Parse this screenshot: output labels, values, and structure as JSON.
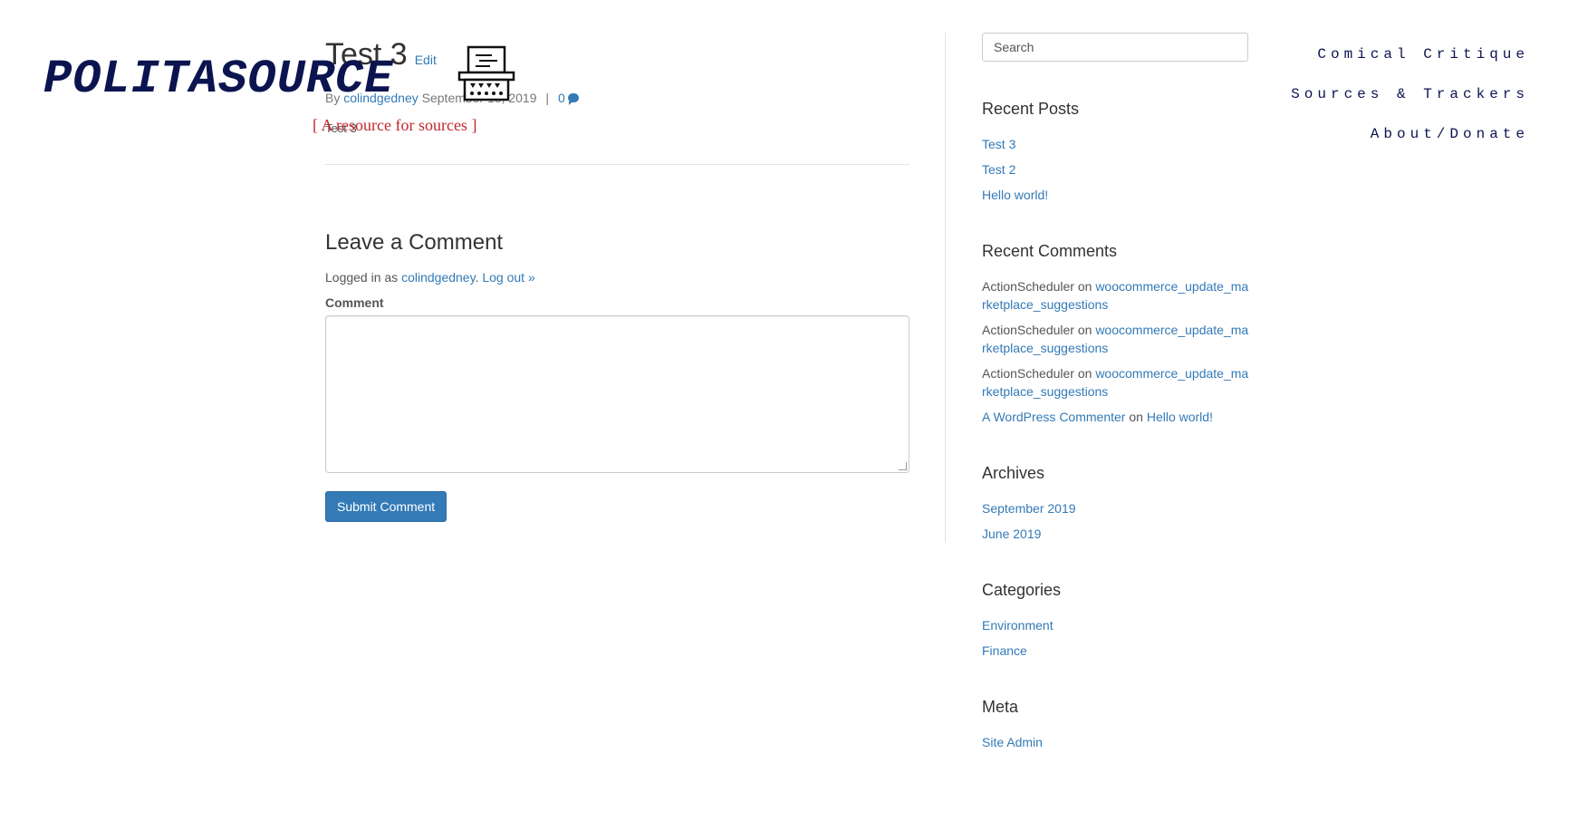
{
  "site": {
    "logo_text": "POLITASOURCE",
    "tagline": "[ A resource for sources ]"
  },
  "topnav": {
    "items": [
      "Comical Critique",
      "Sources & Trackers",
      "About/Donate"
    ]
  },
  "post": {
    "title": "Test 3",
    "edit_label": "Edit",
    "meta_by": "By",
    "author": "colindgedney",
    "date": "September 18, 2019",
    "separator": "|",
    "comment_count": "0",
    "body": "Test 3"
  },
  "comments": {
    "heading": "Leave a Comment",
    "logged_in_prefix": "Logged in as",
    "user": "colindgedney",
    "logout_label": "Log out »",
    "comment_label": "Comment",
    "submit_label": "Submit Comment"
  },
  "sidebar": {
    "search_placeholder": "Search",
    "recent_posts": {
      "title": "Recent Posts",
      "items": [
        "Test 3",
        "Test 2",
        "Hello world!"
      ]
    },
    "recent_comments": {
      "title": "Recent Comments",
      "items": [
        {
          "author": "ActionScheduler",
          "on": "on",
          "post": "woocommerce_update_marketplace_suggestions"
        },
        {
          "author": "ActionScheduler",
          "on": "on",
          "post": "woocommerce_update_marketplace_suggestions"
        },
        {
          "author": "ActionScheduler",
          "on": "on",
          "post": "woocommerce_update_marketplace_suggestions"
        },
        {
          "author": "A WordPress Commenter",
          "on": "on",
          "post": "Hello world!"
        }
      ]
    },
    "archives": {
      "title": "Archives",
      "items": [
        "September 2019",
        "June 2019"
      ]
    },
    "categories": {
      "title": "Categories",
      "items": [
        "Environment",
        "Finance"
      ]
    },
    "meta": {
      "title": "Meta",
      "items": [
        "Site Admin"
      ]
    }
  },
  "colors": {
    "link": "#337ab7",
    "logo": "#0c1450",
    "tagline": "#c0272d",
    "button": "#337ab7"
  }
}
